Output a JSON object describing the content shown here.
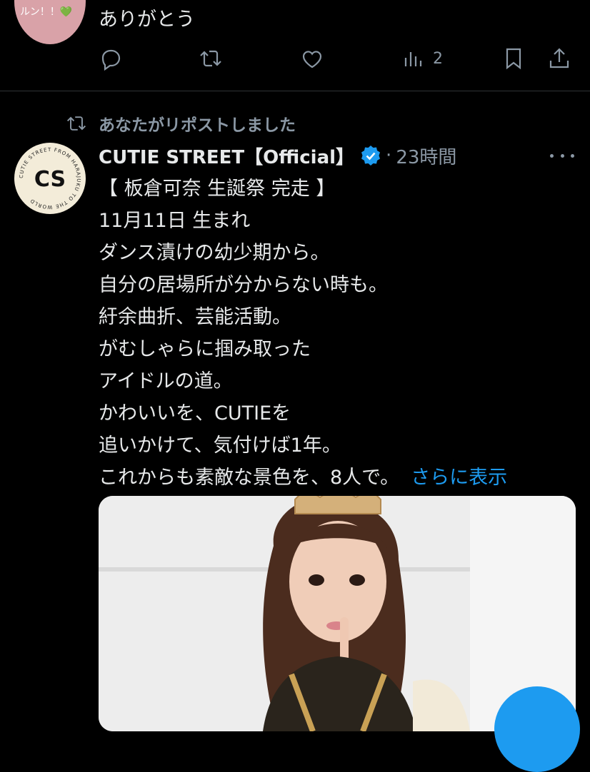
{
  "previous_tweet": {
    "avatar_text": "ルン！！💚",
    "text": "ありがとう",
    "actions": {
      "reply_icon": "reply-icon",
      "repost_icon": "repost-icon",
      "like_icon": "heart-icon",
      "views_icon": "views-chart-icon",
      "views_count": "2",
      "bookmark_icon": "bookmark-icon",
      "share_icon": "share-icon"
    }
  },
  "repost_banner": {
    "icon": "repost-icon",
    "text": "あなたがリポストしました"
  },
  "tweet": {
    "author": "CUTIE STREET【Official】",
    "verified_icon": "verified-badge-icon",
    "separator": "·",
    "time": "23時間",
    "more_icon": "more-icon",
    "lines": [
      "【 板倉可奈 生誕祭 完走 】",
      "11月11日 生まれ",
      "ダンス漬けの幼少期から。",
      "自分の居場所が分からない時も。",
      "紆余曲折、芸能活動。",
      "がむしゃらに掴み取った",
      "アイドルの道。",
      "かわいいを、CUTIEを",
      "追いかけて、気付けば1年。",
      "これからも素敵な景色を、8人で。"
    ],
    "show_more": "さらに表示",
    "logo_ring_text": "CUTIE STREET FROM HARAJUKU TO THE WORLD",
    "logo_text": "CS"
  },
  "colors": {
    "background": "#000000",
    "text": "#e7e9ea",
    "muted": "#8b98a5",
    "accent": "#1d9bf0",
    "divider": "#2f3336"
  }
}
